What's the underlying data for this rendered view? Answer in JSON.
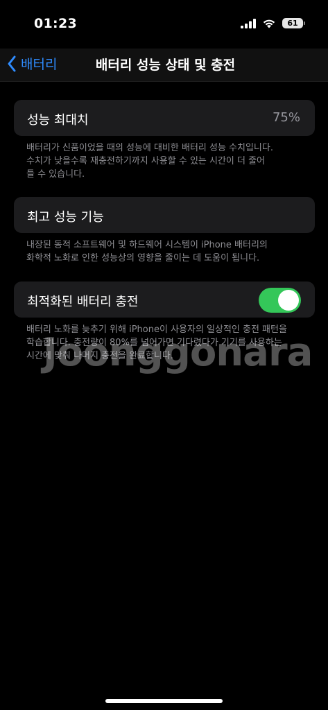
{
  "status_bar": {
    "time": "01:23",
    "battery_level": "61"
  },
  "nav": {
    "back_label": "배터리",
    "title": "배터리 성능 상태 및 충전"
  },
  "max_capacity": {
    "title": "성능 최대치",
    "value": "75%",
    "footnote_lines": [
      "배터리가 신품이었을 때의 성능에 대비한 배터리 성능 수치입니다.",
      "수치가 낮을수록 재충전하기까지 사용할 수 있는 시간이 더 줄어",
      "들 수 있습니다."
    ]
  },
  "peak_performance": {
    "title": "최고 성능 기능",
    "footnote_lines": [
      "내장된 동적 소프트웨어 및 하드웨어 시스템이 iPhone 배터리의",
      "화학적 노화로 인한 성능상의 영향을 줄이는 데 도움이 됩니다."
    ]
  },
  "optimized_charging": {
    "title": "최적화된 배터리 충전",
    "enabled": true,
    "footnote_lines": [
      "배터리 노화를 늦추기 위해 iPhone이 사용자의 일상적인 충전 패턴을",
      "학습합니다. 충전량이 80%를 넘어가면 기다렸다가 기기를 사용하는",
      "시간에 맞춰 나머지 충전을 완료합니다."
    ]
  },
  "watermark": "Joonggonara",
  "colors": {
    "accent": "#2f8cff",
    "toggle_on": "#34c759",
    "card": "#1c1c1e",
    "secondary_text": "#8e8e93"
  }
}
